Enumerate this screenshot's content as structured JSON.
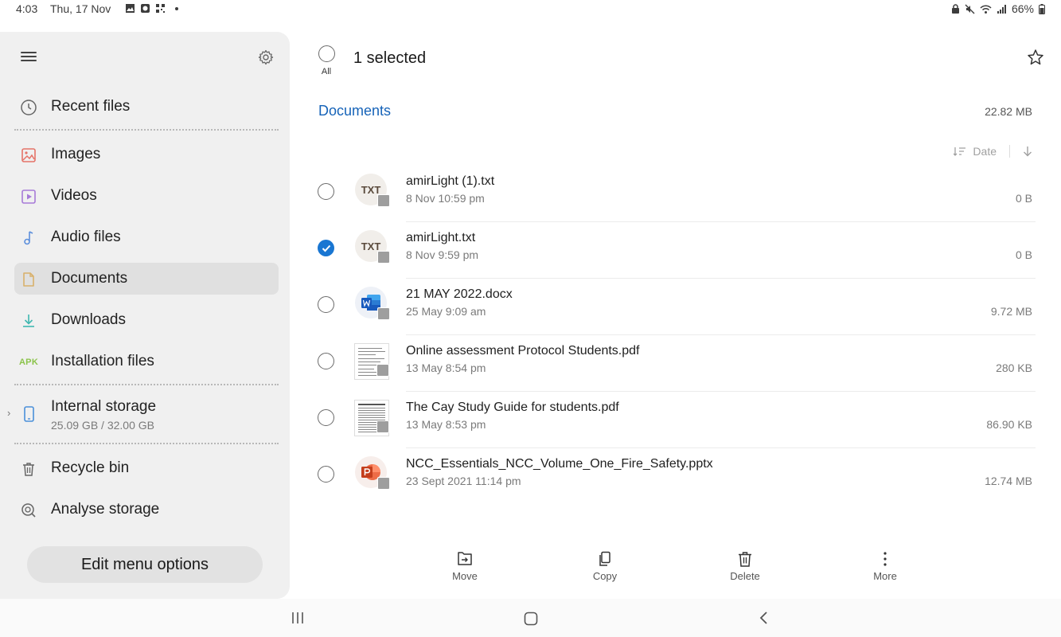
{
  "status_bar": {
    "time": "4:03",
    "date": "Thu, 17 Nov",
    "battery": "66%"
  },
  "drawer": {
    "items": [
      {
        "label": "Recent files",
        "icon": "clock-icon"
      },
      {
        "label": "Images",
        "icon": "image-icon"
      },
      {
        "label": "Videos",
        "icon": "video-icon"
      },
      {
        "label": "Audio files",
        "icon": "music-note-icon"
      },
      {
        "label": "Documents",
        "icon": "document-icon",
        "active": true
      },
      {
        "label": "Downloads",
        "icon": "download-icon"
      },
      {
        "label": "Installation files",
        "icon": "apk-icon",
        "icon_text": "APK"
      },
      {
        "label": "Internal storage",
        "sub": "25.09 GB / 32.00 GB",
        "icon": "phone-icon"
      },
      {
        "label": "Recycle bin",
        "icon": "trash-icon"
      },
      {
        "label": "Analyse storage",
        "icon": "analyse-icon"
      }
    ],
    "edit_button": "Edit menu options"
  },
  "header": {
    "all_label": "All",
    "selection_title": "1 selected"
  },
  "folder": {
    "title": "Documents",
    "size": "22.82 MB",
    "sort_label": "Date"
  },
  "files": [
    {
      "name": "amirLight (1).txt",
      "date": "8 Nov 10:59 pm",
      "size": "0 B",
      "type": "txt",
      "thumb_text": "TXT",
      "selected": false
    },
    {
      "name": "amirLight.txt",
      "date": "8 Nov 9:59 pm",
      "size": "0 B",
      "type": "txt",
      "thumb_text": "TXT",
      "selected": true
    },
    {
      "name": "21 MAY 2022.docx",
      "date": "25 May 9:09 am",
      "size": "9.72 MB",
      "type": "docx",
      "selected": false
    },
    {
      "name": "Online assessment Protocol Students.pdf",
      "date": "13 May 8:54 pm",
      "size": "280 KB",
      "type": "pdf",
      "selected": false
    },
    {
      "name": "The Cay Study Guide for students.pdf",
      "date": "13 May 8:53 pm",
      "size": "86.90 KB",
      "type": "pdf",
      "selected": false
    },
    {
      "name": "NCC_Essentials_NCC_Volume_One_Fire_Safety.pptx",
      "date": "23 Sept 2021 11:14 pm",
      "size": "12.74 MB",
      "type": "pptx",
      "selected": false
    }
  ],
  "actions": {
    "move": "Move",
    "copy": "Copy",
    "delete": "Delete",
    "more": "More"
  },
  "colors": {
    "accent": "#1976d2",
    "folder_title": "#1663b8",
    "drawer_bg": "#f0f0f0"
  }
}
